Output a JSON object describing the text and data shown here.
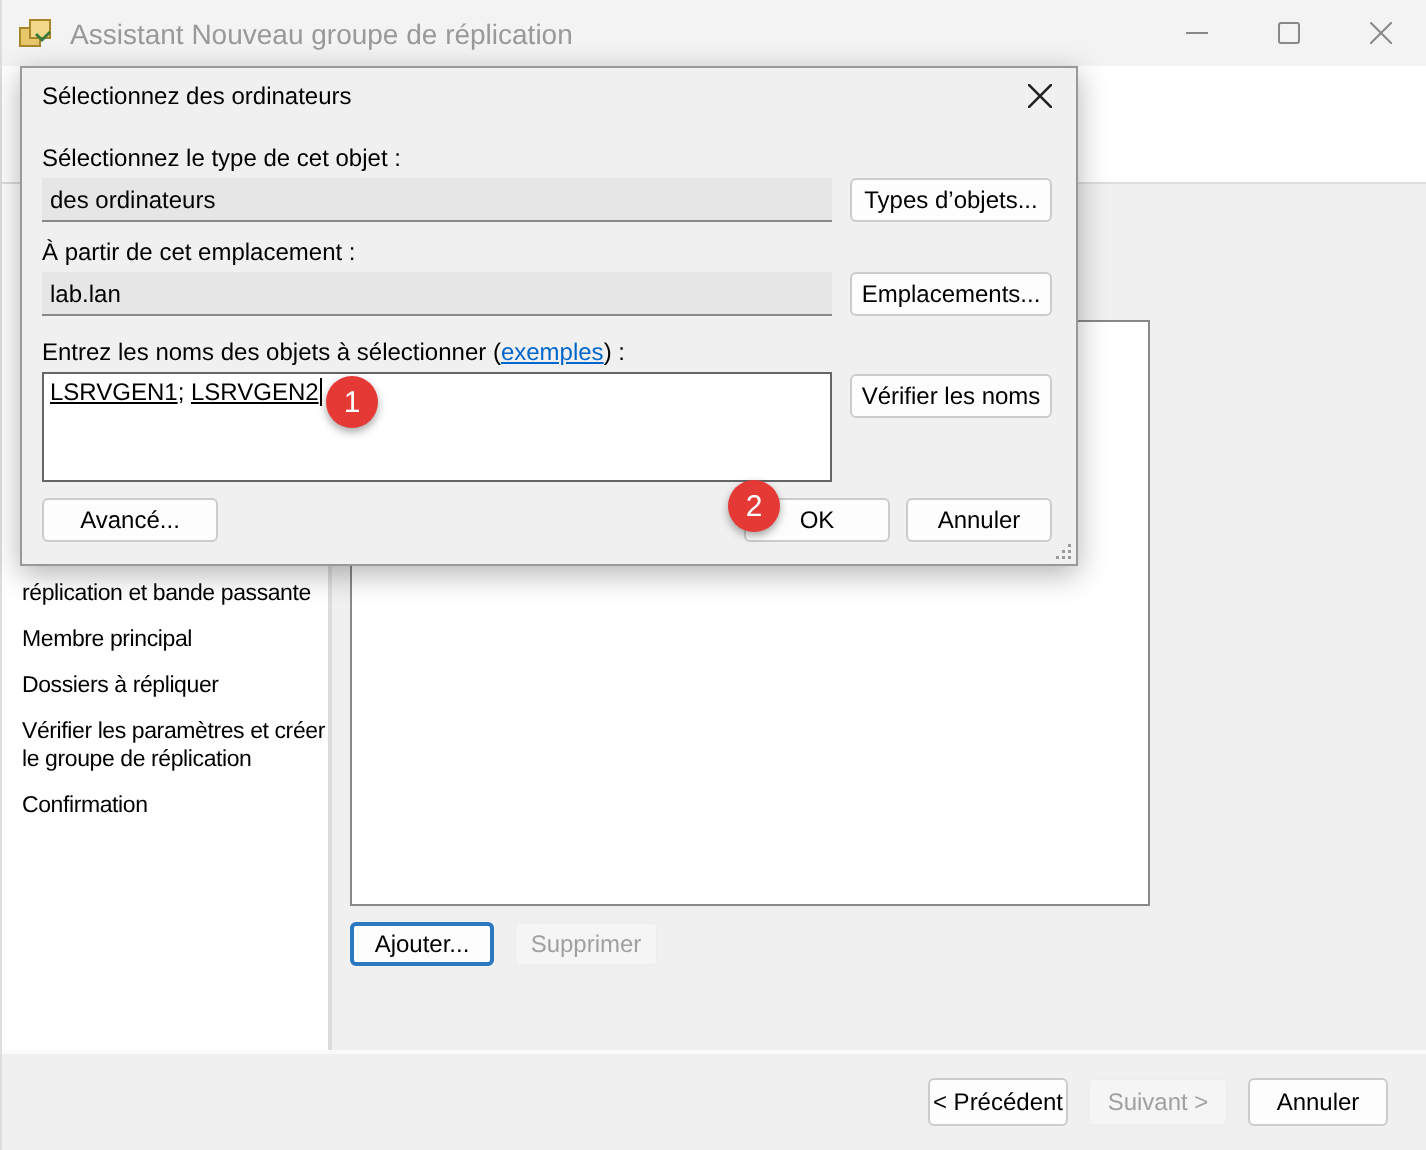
{
  "wizard": {
    "title": "Assistant Nouveau groupe de réplication",
    "steps": [
      {
        "label": "réplication et bande passante"
      },
      {
        "label": "Membre principal"
      },
      {
        "label": "Dossiers à répliquer"
      },
      {
        "label": "Vérifier les paramètres et créer le groupe de réplication"
      },
      {
        "label": "Confirmation"
      }
    ],
    "list_buttons": [
      {
        "label": "Ajouter...",
        "disabled": false,
        "focused": true
      },
      {
        "label": "Supprimer",
        "disabled": true,
        "focused": false
      }
    ],
    "footer_buttons": [
      {
        "label": "< Précédent",
        "disabled": false
      },
      {
        "label": "Suivant >",
        "disabled": true
      },
      {
        "label": "Annuler",
        "disabled": false
      }
    ]
  },
  "dialog": {
    "title": "Sélectionnez des ordinateurs",
    "type_label": "Sélectionnez le type de cet objet :",
    "type_value": "des ordinateurs",
    "type_button": "Types d’objets...",
    "location_label": "À partir de cet emplacement :",
    "location_value": "lab.lan",
    "location_button": "Emplacements...",
    "names_label_before": "Entrez les noms des objets à sélectionner (",
    "names_link": "exemples",
    "names_label_after": ") :",
    "names": [
      "LSRVGEN1",
      "LSRVGEN2"
    ],
    "names_separator": "; ",
    "check_button": "Vérifier les noms",
    "advanced_button": "Avancé...",
    "ok_button": "OK",
    "cancel_button": "Annuler"
  },
  "badges": [
    {
      "label": "1"
    },
    {
      "label": "2"
    }
  ]
}
